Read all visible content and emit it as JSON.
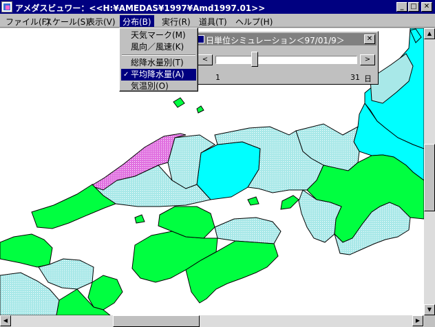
{
  "window": {
    "title": "アメダスビュワー：<<H:¥AMEDAS¥1997¥Amd1997.01>>",
    "minimize": "_",
    "maximize": "□",
    "close": "✕"
  },
  "menubar": {
    "items": [
      {
        "label": "ファイル(F)"
      },
      {
        "label": "スケール(S)"
      },
      {
        "label": "表示(V)"
      },
      {
        "label": "分布(B)"
      },
      {
        "label": "実行(R)"
      },
      {
        "label": "道具(T)"
      },
      {
        "label": "ヘルプ(H)"
      }
    ]
  },
  "dropdown": {
    "items": [
      {
        "label": "天気マーク(M)",
        "checked": false,
        "selected": false
      },
      {
        "label": "風向／風速(K)",
        "checked": false,
        "selected": false
      },
      {
        "label": "総降水量別(T)",
        "checked": false,
        "selected": false
      },
      {
        "label": "平均降水量(A)",
        "checked": true,
        "selected": true
      },
      {
        "label": "気温別(O)",
        "checked": false,
        "selected": false
      }
    ],
    "check_mark": "✓"
  },
  "simulation": {
    "title": "日単位シミュレーション＜97/01/9＞",
    "close": "✕",
    "prev": "<",
    "next": ">",
    "min_label": "1",
    "max_label": "31",
    "unit_label": "日",
    "min": 1,
    "max": 31,
    "value": 9
  },
  "scroll": {
    "up": "▲",
    "down": "▼",
    "left": "◀",
    "right": "▶"
  },
  "colors": {
    "title_active": "#000080",
    "title_inactive": "#808080",
    "region_green": "#00ff40",
    "region_cyan": "#00ffff",
    "region_lightcyan": "#a8e8e8",
    "region_magenta": "#e070e0",
    "sea": "#ffffff"
  }
}
